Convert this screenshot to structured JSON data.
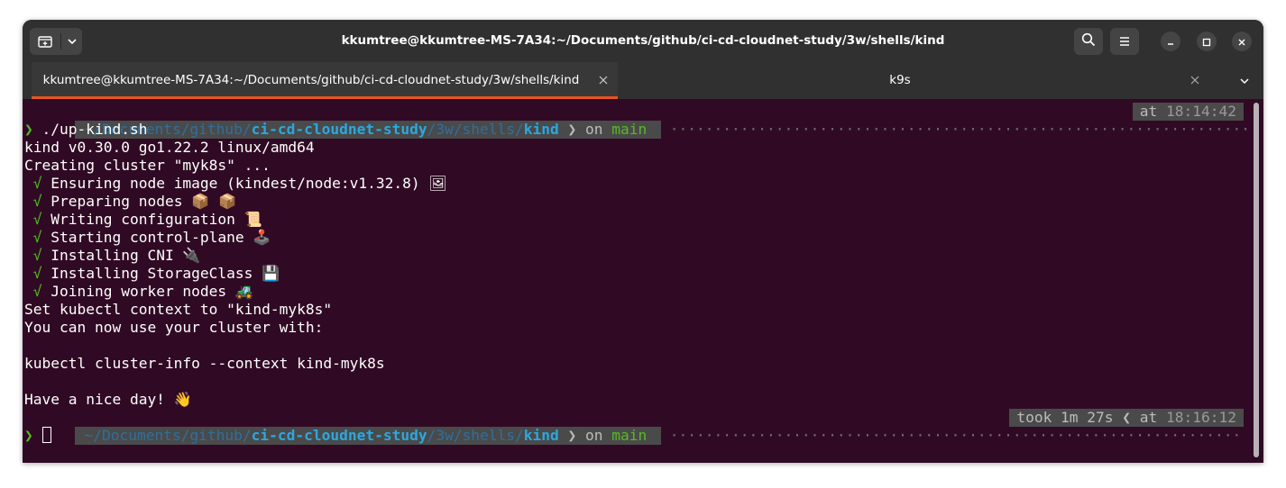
{
  "window": {
    "title": "kkumtree@kkumtree-MS-7A34:~/Documents/github/ci-cd-cloudnet-study/3w/shells/kind"
  },
  "tabs": [
    {
      "label": "kkumtree@kkumtree-MS-7A34:~/Documents/github/ci-cd-cloudnet-study/3w/shells/kind",
      "active": true
    },
    {
      "label": "k9s",
      "active": false
    }
  ],
  "prompt1": {
    "path_dim": "~/Documents/github/",
    "path_bold1": "ci-cd-cloudnet-study",
    "path_dim2": "/3w/shells/",
    "path_bold2": "kind",
    "on": "on",
    "branch": "main",
    "at": "at",
    "time": "18:14:42"
  },
  "command": "./up-kind.sh",
  "output": {
    "line1": "kind v0.30.0 go1.22.2 linux/amd64",
    "line2": "Creating cluster \"myk8s\" ...",
    "steps": [
      {
        "check": "√",
        "text": "Ensuring node image (kindest/node:v1.32.8) 🖼"
      },
      {
        "check": "√",
        "text": "Preparing nodes 📦 📦"
      },
      {
        "check": "√",
        "text": "Writing configuration 📜"
      },
      {
        "check": "√",
        "text": "Starting control-plane 🕹️"
      },
      {
        "check": "√",
        "text": "Installing CNI 🔌"
      },
      {
        "check": "√",
        "text": "Installing StorageClass 💾"
      },
      {
        "check": "√",
        "text": "Joining worker nodes 🚜"
      }
    ],
    "context": "Set kubectl context to \"kind-myk8s\"",
    "usage": "You can now use your cluster with:",
    "kubectl": "kubectl cluster-info --context kind-myk8s",
    "bye": "Have a nice day! 👋"
  },
  "prompt2": {
    "path_dim": "~/Documents/github/",
    "path_bold1": "ci-cd-cloudnet-study",
    "path_dim2": "/3w/shells/",
    "path_bold2": "kind",
    "on": "on",
    "branch": "main",
    "took": "took 1m 27s",
    "at": "at",
    "time": "18:16:12"
  },
  "prompt_char": "❯",
  "icons": [
    "new-tab-icon",
    "dropdown-icon",
    "search-icon",
    "hamburger-menu-icon",
    "minimize-icon",
    "maximize-icon",
    "close-icon"
  ]
}
